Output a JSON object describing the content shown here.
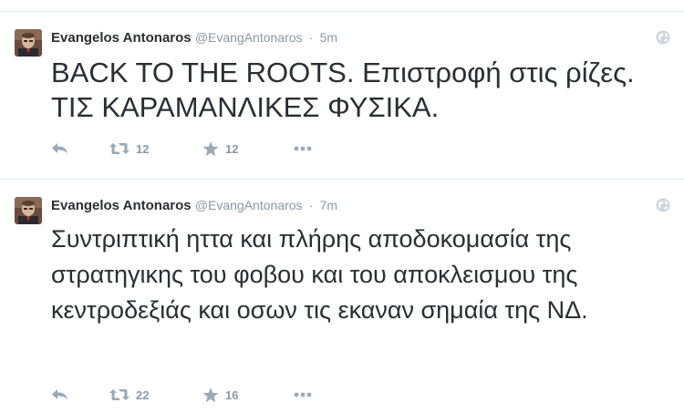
{
  "colors": {
    "text": "#292f33",
    "muted": "#8899a6",
    "icon": "#9aa9b6",
    "divider": "#e1e8ed"
  },
  "tweets": [
    {
      "fullname": "Evangelos Antonaros",
      "username": "@EvangAntonaros",
      "separator": "·",
      "time": "5m",
      "text": "BACK TO THE ROOTS. Επιστροφή στις ρίζες. ΤΙΣ ΚΑΡΑΜΑΝΛΙΚΕΣ ΦΥΣΙΚΑ.",
      "retweets": "12",
      "favorites": "12",
      "icons": [
        "reply-icon",
        "retweet-icon",
        "star-icon",
        "more-icon",
        "globe-icon"
      ]
    },
    {
      "fullname": "Evangelos Antonaros",
      "username": "@EvangAntonaros",
      "separator": "·",
      "time": "7m",
      "text": "Συντριπτική ηττα και πλήρης αποδοκομασία της στρατηγικης του φοβου και του αποκλεισμου της κεντροδεξιάς και οσων τις εκαναν σημαία της ΝΔ.",
      "retweets": "22",
      "favorites": "16",
      "icons": [
        "reply-icon",
        "retweet-icon",
        "star-icon",
        "more-icon",
        "globe-icon"
      ]
    }
  ]
}
